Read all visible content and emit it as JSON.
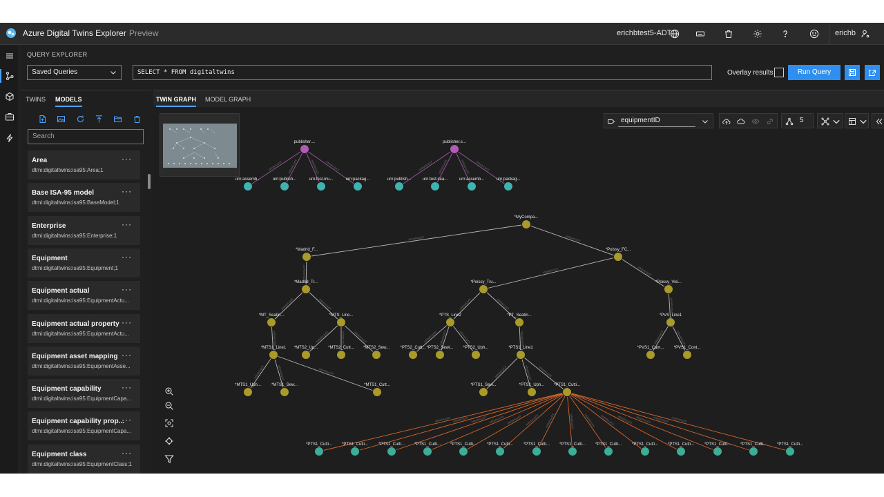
{
  "app": {
    "title": "Azure Digital Twins Explorer",
    "preview": "Preview",
    "instance": "erichbtest5-ADT",
    "user": "erichb"
  },
  "query": {
    "section_label": "QUERY EXPLORER",
    "saved_queries": "Saved Queries",
    "text": "SELECT * FROM digitaltwins",
    "overlay_label": "Overlay results",
    "overlay_checked": false,
    "run_label": "Run Query"
  },
  "left_panel": {
    "tabs": [
      {
        "label": "TWINS",
        "active": false
      },
      {
        "label": "MODELS",
        "active": true
      }
    ],
    "search_placeholder": "Search",
    "models": [
      {
        "name": "Area",
        "id": "dtmi:digitaltwins:isa95:Area;1"
      },
      {
        "name": "Base ISA-95 model",
        "id": "dtmi:digitaltwins:isa95:BaseModel;1"
      },
      {
        "name": "Enterprise",
        "id": "dtmi:digitaltwins:isa95:Enterprise;1"
      },
      {
        "name": "Equipment",
        "id": "dtmi:digitaltwins:isa95:Equipment;1"
      },
      {
        "name": "Equipment actual",
        "id": "dtmi:digitaltwins:isa95:EquipmentActu..."
      },
      {
        "name": "Equipment actual property",
        "id": "dtmi:digitaltwins:isa95:EquipmentActu..."
      },
      {
        "name": "Equipment asset mapping",
        "id": "dtmi:digitaltwins:isa95:EquipmentAsse..."
      },
      {
        "name": "Equipment capability",
        "id": "dtmi:digitaltwins:isa95:EquipmentCapa..."
      },
      {
        "name": "Equipment capability prop...",
        "id": "dtmi:digitaltwins:isa95:EquipmentCapa..."
      },
      {
        "name": "Equipment class",
        "id": "dtmi:digitaltwins:isa95:EquipmentClass;1"
      }
    ],
    "more_label": "···"
  },
  "graph": {
    "tabs": [
      {
        "label": "TWIN GRAPH",
        "active": true
      },
      {
        "label": "MODEL GRAPH",
        "active": false
      }
    ],
    "label_field": "equipmentID",
    "expansion_level": "5",
    "colors": {
      "publisher": "#b15bb5",
      "twin": "#a99a2a",
      "leaf": "#3fb3b0",
      "cutting": "#3cae97",
      "edge": "#b9b9b9",
      "orange_edge": "#d8672a",
      "purple_edge": "#9a5aa0"
    },
    "nodes": [
      {
        "id": "pub1",
        "label": "publisher....",
        "type": "publisher"
      },
      {
        "id": "pub2",
        "label": "publisher.s...",
        "type": "publisher"
      },
      {
        "id": "u1",
        "label": "urn:assemb...",
        "type": "leaf"
      },
      {
        "id": "u2",
        "label": "urn:publish...",
        "type": "leaf"
      },
      {
        "id": "u3",
        "label": "urn:test.mu...",
        "type": "leaf"
      },
      {
        "id": "u4",
        "label": "urn:packag...",
        "type": "leaf"
      },
      {
        "id": "u5",
        "label": "urn:publish...",
        "type": "leaf"
      },
      {
        "id": "u6",
        "label": "urn:test.sea...",
        "type": "leaf"
      },
      {
        "id": "u7",
        "label": "urn:assemb...",
        "type": "leaf"
      },
      {
        "id": "u8",
        "label": "urn:packag...",
        "type": "leaf"
      },
      {
        "id": "myco",
        "label": "*MyCompa...",
        "type": "twin"
      },
      {
        "id": "madridF",
        "label": "*Madrid_F...",
        "type": "twin"
      },
      {
        "id": "poissyFC",
        "label": "*Poissy_FC...",
        "type": "twin"
      },
      {
        "id": "madridTr",
        "label": "*Madrid_Tr...",
        "type": "twin"
      },
      {
        "id": "poissyTru",
        "label": "*Poissy_Tru...",
        "type": "twin"
      },
      {
        "id": "poissyVisi",
        "label": "*Poissy_Visi...",
        "type": "twin"
      },
      {
        "id": "mtSeatin",
        "label": "*MT_Seatin...",
        "type": "twin"
      },
      {
        "id": "mtsLine",
        "label": "*MTS_Line...",
        "type": "twin"
      },
      {
        "id": "ptsLine2",
        "label": "*PTS_Line2",
        "type": "twin"
      },
      {
        "id": "ptSeatin",
        "label": "*PT_Seatin...",
        "type": "twin"
      },
      {
        "id": "pvsLine1",
        "label": "*PVS_Line1",
        "type": "twin"
      },
      {
        "id": "mts1Line1",
        "label": "*MTS1_Line1",
        "type": "twin"
      },
      {
        "id": "mts2Up",
        "label": "*MTS2_Up...",
        "type": "twin"
      },
      {
        "id": "mts2Cutt",
        "label": "*MTS2_Cutt...",
        "type": "twin"
      },
      {
        "id": "mts2Sew",
        "label": "*MTS2_Sew...",
        "type": "twin"
      },
      {
        "id": "pts2Cutt",
        "label": "*PTS2_Cutt...",
        "type": "twin"
      },
      {
        "id": "pts2Sewi",
        "label": "*PTS2_Sewi...",
        "type": "twin"
      },
      {
        "id": "pts2Uph",
        "label": "*PTS2_Uph...",
        "type": "twin"
      },
      {
        "id": "pts1Line1",
        "label": "*PTS1_Line1",
        "type": "twin"
      },
      {
        "id": "pvs1Cam",
        "label": "*PVS1_Cam...",
        "type": "twin"
      },
      {
        "id": "pvs1Cont",
        "label": "*PVS1_Cont...",
        "type": "twin"
      },
      {
        "id": "mts1Uph",
        "label": "*MTS1_Uph...",
        "type": "twin"
      },
      {
        "id": "mts1Sew",
        "label": "*MTS1_Sew...",
        "type": "twin"
      },
      {
        "id": "mts1Cutt",
        "label": "*MTS1_Cutt...",
        "type": "twin"
      },
      {
        "id": "pts1Sew",
        "label": "*PTS1_Sew...",
        "type": "twin"
      },
      {
        "id": "pts1Uph",
        "label": "*PTS1_Uph...",
        "type": "twin"
      },
      {
        "id": "pts1Cutti",
        "label": "*PTS1_Cutti...",
        "type": "twin"
      },
      {
        "id": "c1",
        "label": "*PTS1_Cutti...",
        "type": "cutting"
      },
      {
        "id": "c2",
        "label": "*PTS1_Cutti...",
        "type": "cutting"
      },
      {
        "id": "c3",
        "label": "*PTS1_Cutti...",
        "type": "cutting"
      },
      {
        "id": "c4",
        "label": "*PTS1_Cutti...",
        "type": "cutting"
      },
      {
        "id": "c5",
        "label": "*PTS1_Cutti...",
        "type": "cutting"
      },
      {
        "id": "c6",
        "label": "*PTS1_Cutti...",
        "type": "cutting"
      },
      {
        "id": "c7",
        "label": "*PTS1_Cutti...",
        "type": "cutting"
      },
      {
        "id": "c8",
        "label": "*PTS1_Cutti...",
        "type": "cutting"
      },
      {
        "id": "c9",
        "label": "*PTS1_Cutti...",
        "type": "cutting"
      },
      {
        "id": "c10",
        "label": "*PTS1_Cutti...",
        "type": "cutting"
      },
      {
        "id": "c11",
        "label": "*PTS1_Cutti...",
        "type": "cutting"
      },
      {
        "id": "c12",
        "label": "*PTS1_Cutti...",
        "type": "cutting"
      },
      {
        "id": "c13",
        "label": "*PTS1_Cutti...",
        "type": "cutting"
      },
      {
        "id": "c14",
        "label": "*PTS1_Cutti...",
        "type": "cutting"
      }
    ],
    "edges": [
      [
        "pub1",
        "u1"
      ],
      [
        "pub1",
        "u2"
      ],
      [
        "pub1",
        "u3"
      ],
      [
        "pub1",
        "u4"
      ],
      [
        "pub2",
        "u5"
      ],
      [
        "pub2",
        "u6"
      ],
      [
        "pub2",
        "u7"
      ],
      [
        "pub2",
        "u8"
      ],
      [
        "myco",
        "madridF"
      ],
      [
        "myco",
        "poissyFC"
      ],
      [
        "madridF",
        "madridTr"
      ],
      [
        "poissyFC",
        "poissyTru"
      ],
      [
        "poissyFC",
        "poissyVisi"
      ],
      [
        "madridTr",
        "mtSeatin"
      ],
      [
        "madridTr",
        "mtsLine"
      ],
      [
        "poissyTru",
        "ptsLine2"
      ],
      [
        "poissyTru",
        "ptSeatin"
      ],
      [
        "poissyVisi",
        "pvsLine1"
      ],
      [
        "mtSeatin",
        "mts1Line1"
      ],
      [
        "mtsLine",
        "mts2Up"
      ],
      [
        "mtsLine",
        "mts2Cutt"
      ],
      [
        "mtsLine",
        "mts2Sew"
      ],
      [
        "ptsLine2",
        "pts2Cutt"
      ],
      [
        "ptsLine2",
        "pts2Sewi"
      ],
      [
        "ptsLine2",
        "pts2Uph"
      ],
      [
        "ptSeatin",
        "pts1Line1"
      ],
      [
        "pvsLine1",
        "pvs1Cam"
      ],
      [
        "pvsLine1",
        "pvs1Cont"
      ],
      [
        "mts1Line1",
        "mts1Uph"
      ],
      [
        "mts1Line1",
        "mts1Sew"
      ],
      [
        "mts1Line1",
        "mts1Cutt"
      ],
      [
        "pts1Line1",
        "pts1Sew"
      ],
      [
        "pts1Line1",
        "pts1Uph"
      ],
      [
        "pts1Line1",
        "pts1Cutti"
      ],
      [
        "pts1Cutti",
        "c1"
      ],
      [
        "pts1Cutti",
        "c2"
      ],
      [
        "pts1Cutti",
        "c3"
      ],
      [
        "pts1Cutti",
        "c4"
      ],
      [
        "pts1Cutti",
        "c5"
      ],
      [
        "pts1Cutti",
        "c6"
      ],
      [
        "pts1Cutti",
        "c7"
      ],
      [
        "pts1Cutti",
        "c8"
      ],
      [
        "pts1Cutti",
        "c9"
      ],
      [
        "pts1Cutti",
        "c10"
      ],
      [
        "pts1Cutti",
        "c11"
      ],
      [
        "pts1Cutti",
        "c12"
      ],
      [
        "pts1Cutti",
        "c13"
      ],
      [
        "pts1Cutti",
        "c14"
      ]
    ],
    "edge_label": "isMadeUpOf"
  }
}
